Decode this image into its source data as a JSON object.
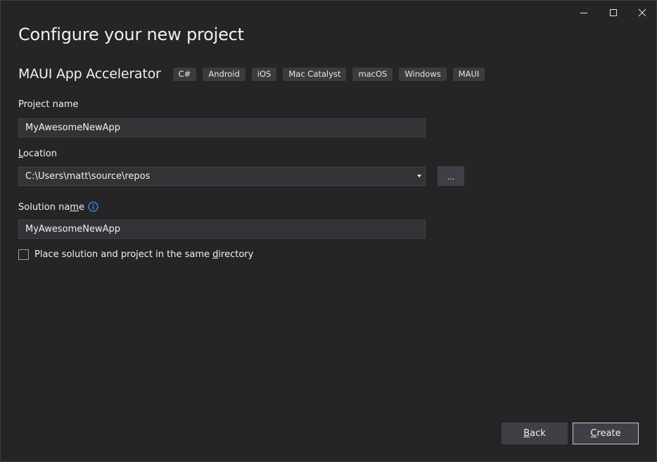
{
  "window": {
    "controls": {
      "minimize_icon": "minimize-icon",
      "maximize_icon": "maximize-icon",
      "close_icon": "close-icon"
    }
  },
  "page": {
    "title": "Configure your new project"
  },
  "template": {
    "name": "MAUI App Accelerator",
    "tags": [
      "C#",
      "Android",
      "iOS",
      "Mac Catalyst",
      "macOS",
      "Windows",
      "MAUI"
    ]
  },
  "form": {
    "project_name": {
      "label": "Project name",
      "value": "MyAwesomeNewApp"
    },
    "location": {
      "label_accel": "L",
      "label_rest": "ocation",
      "value": "C:\\Users\\matt\\source\\repos",
      "browse_label": "..."
    },
    "solution_name": {
      "label_pre": "Solution na",
      "label_accel": "m",
      "label_post": "e",
      "info_icon": "info-icon",
      "value": "MyAwesomeNewApp"
    },
    "same_directory": {
      "label_pre": "Place solution and project in the same ",
      "label_accel": "d",
      "label_post": "irectory",
      "checked": false
    }
  },
  "footer": {
    "back_accel": "B",
    "back_rest": "ack",
    "create_accel": "C",
    "create_rest": "reate"
  },
  "colors": {
    "background": "#252526",
    "input_background": "#333337",
    "button_background": "#3f3f46",
    "text": "#f1f1f1",
    "info_accent": "#3794ff"
  }
}
